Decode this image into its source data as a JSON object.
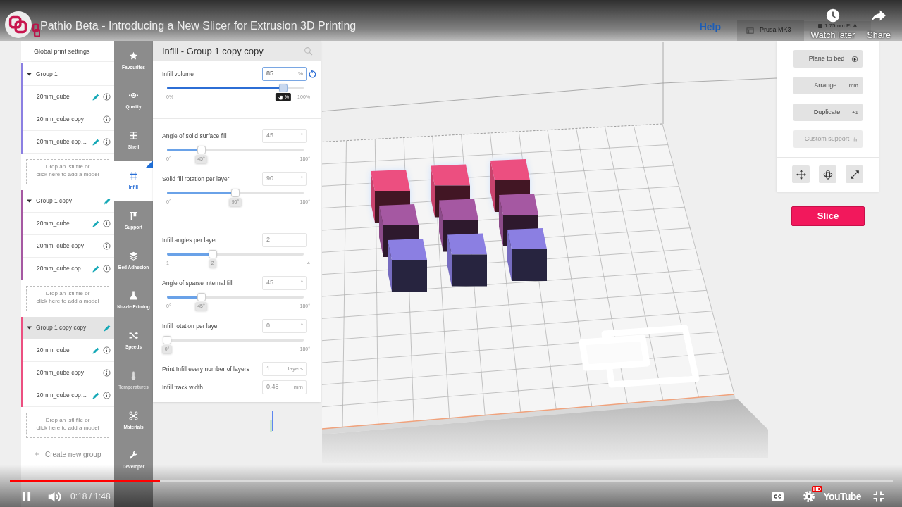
{
  "player": {
    "title": "Pathio Beta - Introducing a New Slicer for Extrusion 3D Printing",
    "actions": [
      "Watch later",
      "Share"
    ],
    "playing": true,
    "progress": {
      "level": 0.17
    },
    "time": "0:18 / 1:48",
    "quality_badge": "HD",
    "logo": "YouTube"
  },
  "app": {
    "header": {
      "help": "Help",
      "printer": "Prusa MK3",
      "material": "1.75mm PLA"
    },
    "sidebar": {
      "global": "Global print settings",
      "groups": [
        {
          "name": "Group 1",
          "color": "#8b7fe2",
          "expanded": true,
          "selected": false,
          "edited": false,
          "models": [
            {
              "name": "20mm_cube",
              "edited": true
            },
            {
              "name": "20mm_cube copy",
              "edited": false
            },
            {
              "name": "20mm_cube cop…",
              "edited": true
            }
          ],
          "dropzone": [
            "Drop an .stl file or",
            "click here to add a model"
          ]
        },
        {
          "name": "Group 1 copy",
          "color": "#a558a2",
          "expanded": true,
          "selected": false,
          "edited": true,
          "models": [
            {
              "name": "20mm_cube",
              "edited": true
            },
            {
              "name": "20mm_cube copy",
              "edited": false
            },
            {
              "name": "20mm_cube cop…",
              "edited": true
            }
          ],
          "dropzone": [
            "Drop an .stl file or",
            "click here to add a model"
          ]
        },
        {
          "name": "Group 1 copy copy",
          "color": "#ec4f80",
          "expanded": true,
          "selected": true,
          "edited": true,
          "models": [
            {
              "name": "20mm_cube",
              "edited": true
            },
            {
              "name": "20mm_cube copy",
              "edited": false
            },
            {
              "name": "20mm_cube cop…",
              "edited": true
            }
          ],
          "dropzone": [
            "Drop an .stl file or",
            "click here to add a model"
          ]
        }
      ],
      "create": "Create new group"
    },
    "nav": [
      {
        "label": "Favourites",
        "selected": false,
        "disabled": false
      },
      {
        "label": "Quality",
        "selected": false,
        "disabled": false
      },
      {
        "label": "Shell",
        "selected": false,
        "disabled": false
      },
      {
        "label": "Infill",
        "selected": true,
        "disabled": false
      },
      {
        "label": "Support",
        "selected": false,
        "disabled": false
      },
      {
        "label": "Bed Adhesion",
        "selected": false,
        "disabled": false
      },
      {
        "label": "Nozzle Priming",
        "selected": false,
        "disabled": false
      },
      {
        "label": "Speeds",
        "selected": false,
        "disabled": false
      },
      {
        "label": "Temperatures",
        "selected": false,
        "disabled": true
      },
      {
        "label": "Materials",
        "selected": false,
        "disabled": false
      },
      {
        "label": "Developer",
        "selected": false,
        "disabled": false
      }
    ],
    "panel": {
      "title": "Infill - Group 1 copy copy",
      "sections": [
        [
          {
            "kind": "slider",
            "label": "Infill volume",
            "value": "85",
            "unit": "%",
            "focused": true,
            "level": 0.85,
            "min": "0%",
            "max": "100%",
            "thumb_label": "%"
          }
        ],
        [
          {
            "kind": "slider",
            "label": "Angle of solid surface fill",
            "value": "45",
            "unit": "°",
            "focused": false,
            "level": 0.25,
            "min": "0°",
            "max": "180°",
            "thumb_label": "45°"
          },
          {
            "kind": "slider",
            "label": "Solid fill rotation per layer",
            "value": "90",
            "unit": "°",
            "focused": false,
            "level": 0.5,
            "min": "0°",
            "max": "180°",
            "thumb_label": "90°"
          }
        ],
        [
          {
            "kind": "slider",
            "label": "Infill angles per layer",
            "value": "2",
            "focused": false,
            "level": 0.3333,
            "min": "1",
            "max": "4",
            "thumb_label": "2"
          },
          {
            "kind": "slider",
            "label": "Angle of sparse internal fill",
            "value": "45",
            "unit": "°",
            "focused": false,
            "level": 0.25,
            "min": "0°",
            "max": "180°",
            "thumb_label": "45°"
          },
          {
            "kind": "slider",
            "label": "Infill rotation per layer",
            "value": "0",
            "unit": "°",
            "focused": false,
            "level": 0,
            "max": "180°",
            "thumb_label": "0°"
          },
          {
            "kind": "field",
            "label": "Print Infill every number of layers",
            "value": "1",
            "unit": "layers",
            "focused": false
          },
          {
            "kind": "field",
            "label": "Infill track width",
            "value": "0.48",
            "unit": "mm",
            "focused": false
          }
        ]
      ]
    },
    "actions": [
      {
        "label": "Plane to bed",
        "kind": "icon",
        "disabled": false
      },
      {
        "label": "Arrange",
        "kind": "text",
        "suffix": "mm",
        "disabled": false
      },
      {
        "label": "Duplicate",
        "kind": "text",
        "suffix": "+1",
        "disabled": false
      },
      {
        "label": "Custom support",
        "kind": "icon",
        "disabled": true
      }
    ],
    "slice": "Slice"
  }
}
